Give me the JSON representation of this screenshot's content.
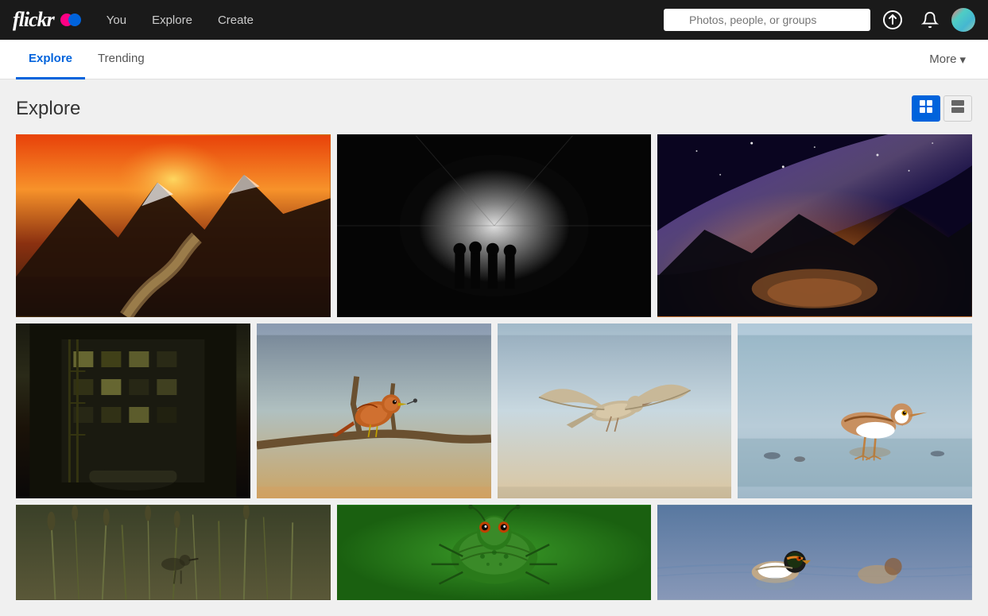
{
  "app": {
    "name": "Flickr",
    "title": "Explore"
  },
  "topnav": {
    "you_label": "You",
    "explore_label": "Explore",
    "create_label": "Create"
  },
  "search": {
    "placeholder": "Photos, people, or groups"
  },
  "subnav": {
    "explore_label": "Explore",
    "trending_label": "Trending",
    "more_label": "More"
  },
  "page": {
    "title": "Explore"
  },
  "viewtoggle": {
    "grid_label": "⊞",
    "list_label": "▤"
  },
  "photos": [
    {
      "id": 1,
      "alt": "Mountain sunset landscape with river"
    },
    {
      "id": 2,
      "alt": "Dark tunnel silhouettes"
    },
    {
      "id": 3,
      "alt": "Milky way over lake"
    },
    {
      "id": 4,
      "alt": "Urban building at night"
    },
    {
      "id": 5,
      "alt": "Bird on branch"
    },
    {
      "id": 6,
      "alt": "Bird in flight"
    },
    {
      "id": 7,
      "alt": "Sandpiper wading bird"
    },
    {
      "id": 8,
      "alt": "Grass and reeds"
    },
    {
      "id": 9,
      "alt": "Green macro bug"
    },
    {
      "id": 10,
      "alt": "Duck on water"
    }
  ]
}
